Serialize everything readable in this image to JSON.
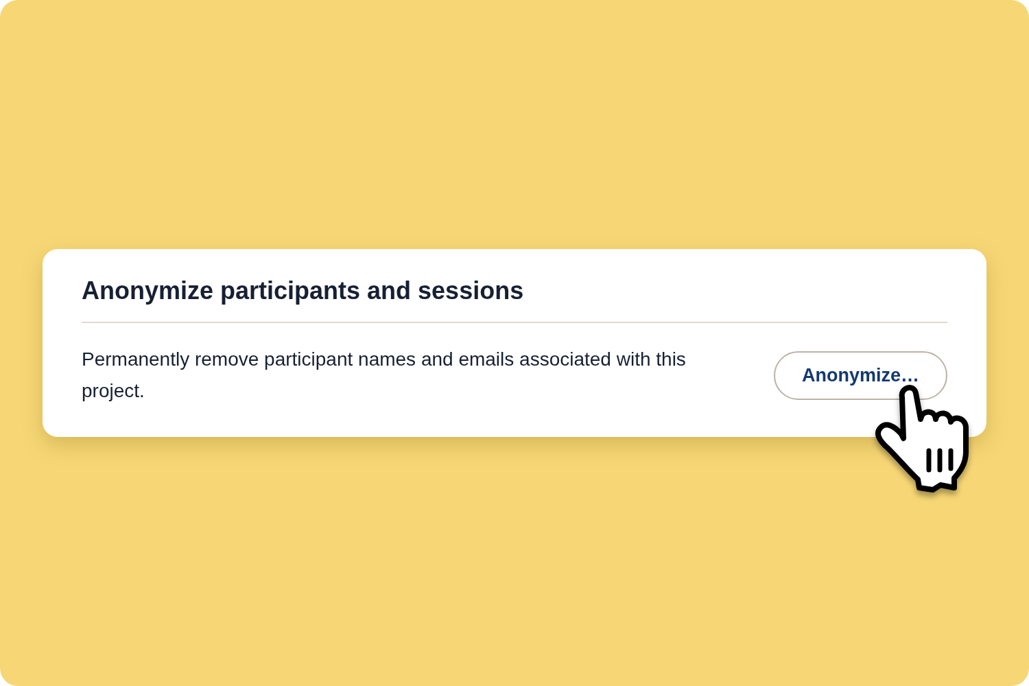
{
  "card": {
    "title": "Anonymize participants and sessions",
    "description": "Permanently remove participant names and emails associated with this project.",
    "button": {
      "label": "Anonymize…"
    }
  }
}
